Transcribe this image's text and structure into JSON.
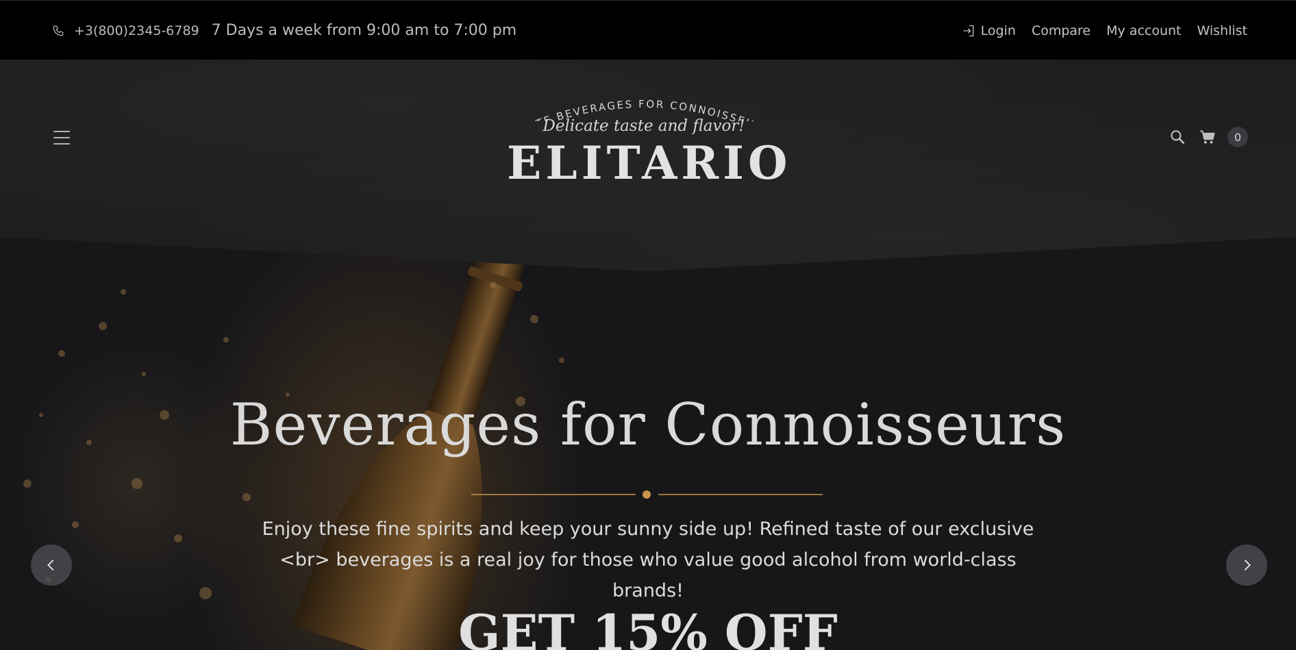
{
  "topbar": {
    "phone": "+3(800)2345-6789",
    "hours": "7 Days a week from 9:00 am to 7:00 pm",
    "links": {
      "login": "Login",
      "compare": "Compare",
      "my_account": "My account",
      "wishlist": "Wishlist"
    }
  },
  "header": {
    "logo_arc_text": "ELITE BEVERAGES FOR CONNOISSEURS",
    "logo_tagline": "Delicate taste and flavor!",
    "logo_name": "ELITARIO",
    "cart_count": "0",
    "icons": [
      "menu-icon",
      "search-icon",
      "cart-icon"
    ]
  },
  "hero": {
    "title": "Beverages for Connoisseurs",
    "description": "Enjoy these fine spirits and keep your sunny side up! Refined taste of our exclusive <br> beverages is a real joy for those who value good alcohol from world-class brands!",
    "promo": "GET 15% OFF"
  },
  "colors": {
    "accent_gold": "#c9964a",
    "topbar_bg": "#000000",
    "header_bg": "#1e1e1e",
    "hero_bg": "#17171a"
  }
}
